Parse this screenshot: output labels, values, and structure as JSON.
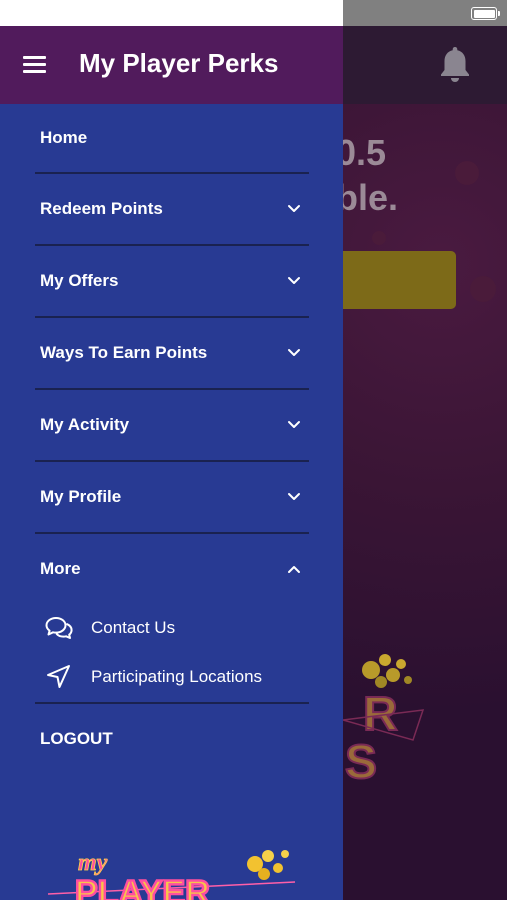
{
  "app": {
    "title": "My Player Perks"
  },
  "background": {
    "headline_line1": "0.5",
    "headline_line2": "ble."
  },
  "menu": {
    "items": [
      {
        "label": "Home",
        "expandable": false
      },
      {
        "label": "Redeem Points",
        "expandable": true,
        "expanded": false
      },
      {
        "label": "My Offers",
        "expandable": true,
        "expanded": false
      },
      {
        "label": "Ways To Earn Points",
        "expandable": true,
        "expanded": false
      },
      {
        "label": "My Activity",
        "expandable": true,
        "expanded": false
      },
      {
        "label": "My Profile",
        "expandable": true,
        "expanded": false
      },
      {
        "label": "More",
        "expandable": true,
        "expanded": true
      }
    ],
    "more_subitems": [
      {
        "label": "Contact Us",
        "icon": "chat-bubbles-icon"
      },
      {
        "label": "Participating Locations",
        "icon": "location-arrow-icon"
      }
    ],
    "logout_label": "LOGOUT"
  },
  "colors": {
    "drawer_bg": "#283a93",
    "header_bg": "#511b5c",
    "text": "#ffffff"
  }
}
